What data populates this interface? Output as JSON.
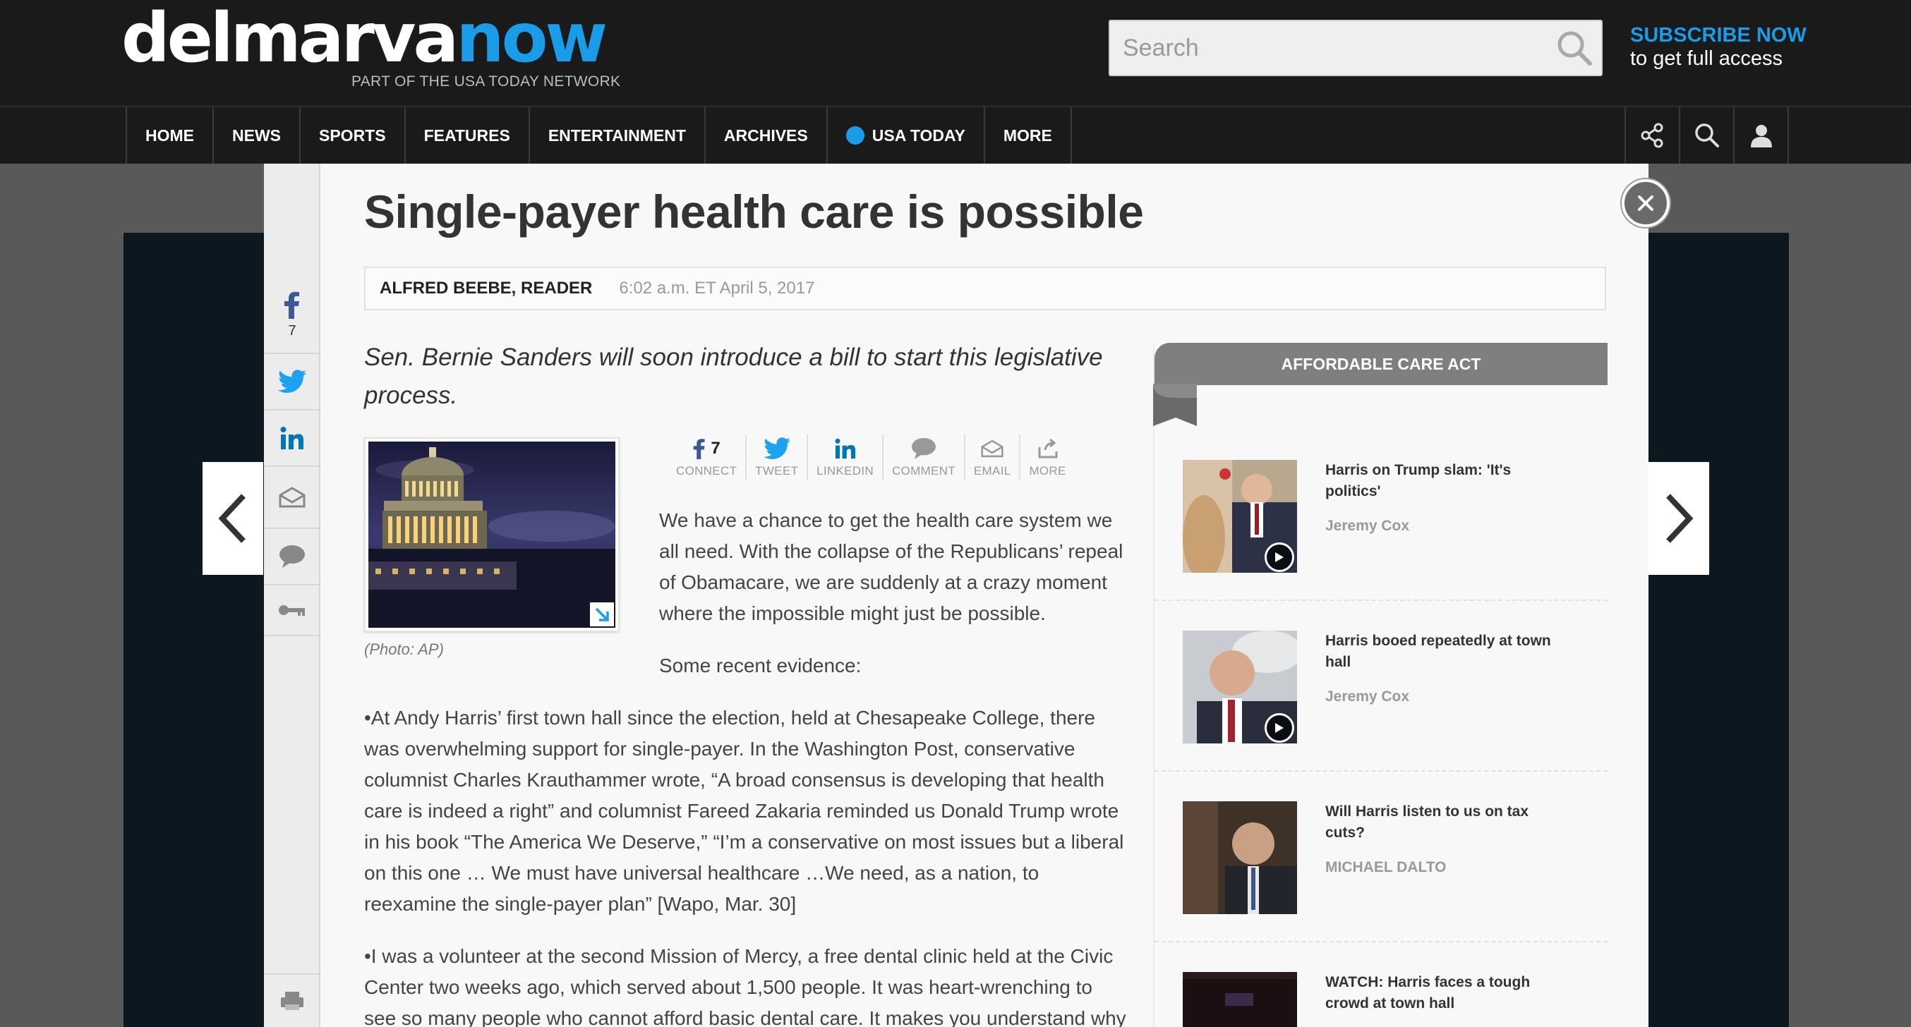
{
  "header": {
    "logo_part1": "delmarva",
    "logo_part2": "now",
    "tagline": "PART OF THE USA TODAY NETWORK",
    "search_placeholder": "Search",
    "subscribe_title": "SUBSCRIBE NOW",
    "subscribe_sub": "to get full access"
  },
  "nav": {
    "items": [
      "HOME",
      "NEWS",
      "SPORTS",
      "FEATURES",
      "ENTERTAINMENT",
      "ARCHIVES",
      "USA TODAY",
      "MORE"
    ],
    "icons": [
      "share-icon",
      "search-icon",
      "user-icon"
    ]
  },
  "share_rail": {
    "facebook_count": "7",
    "buttons": [
      "facebook-icon",
      "twitter-icon",
      "linkedin-icon",
      "email-icon",
      "comment-icon",
      "key-icon"
    ],
    "print": "print-icon"
  },
  "article": {
    "headline": "Single-payer health care is possible",
    "author": "ALFRED BEEBE, READER",
    "timestamp": "6:02 a.m. ET April 5, 2017",
    "dek_line1": "Sen. Bernie Sanders will soon introduce a bill to start this legislative",
    "dek_line2": "process.",
    "photo_caption": "(Photo: AP)",
    "share_bar": {
      "facebook_count": "7",
      "labels": [
        "CONNECT",
        "TWEET",
        "LINKEDIN",
        "COMMENT",
        "EMAIL",
        "MORE"
      ]
    },
    "p1": [
      "We have a chance to get the health care system we",
      "all need. With the collapse of the Republicans’ repeal",
      "of Obamacare, we are suddenly at a crazy moment",
      "where the impossible might just be possible."
    ],
    "p2": "Some recent evidence:",
    "p3": [
      "•At Andy Harris’ first town hall since the election, held at Chesapeake College, there",
      "was overwhelming support for single-payer. In the Washington Post, conservative",
      "columnist Charles Krauthammer wrote, “A broad consensus is developing that health",
      "care is indeed a right” and columnist Fareed Zakaria reminded us Donald Trump wrote",
      "in his book “The America We Deserve,” “I’m a conservative on most issues but a liberal",
      "on this one … We must have universal healthcare …We need, as a nation, to",
      "reexamine the single-payer plan” [Wapo, Mar. 30]"
    ],
    "p4": [
      "•I was a volunteer at the second Mission of Mercy, a free dental clinic held at the Civic",
      "Center two weeks ago, which served about 1,500 people. It was heart-wrenching to",
      "see so many people who cannot afford basic dental care. It makes you understand why"
    ]
  },
  "sidebar": {
    "header": "AFFORDABLE CARE ACT",
    "items": [
      {
        "title1": "Harris on Trump slam: 'It's",
        "title2": "politics'",
        "author": "Jeremy Cox",
        "video": true
      },
      {
        "title1": "Harris booed repeatedly at town",
        "title2": "hall",
        "author": "Jeremy Cox",
        "video": true
      },
      {
        "title1": "Will Harris listen to us on tax",
        "title2": "cuts?",
        "author": "MICHAEL DALTO",
        "video": false
      },
      {
        "title1": "WATCH: Harris faces a tough",
        "title2": "crowd at town hall",
        "author": "",
        "video": false
      }
    ]
  },
  "colors": {
    "brand_blue": "#1a9ce8",
    "header_bg": "#1a1a1a",
    "facebook": "#3b5998",
    "twitter": "#1da1f2",
    "linkedin": "#0077b5"
  }
}
